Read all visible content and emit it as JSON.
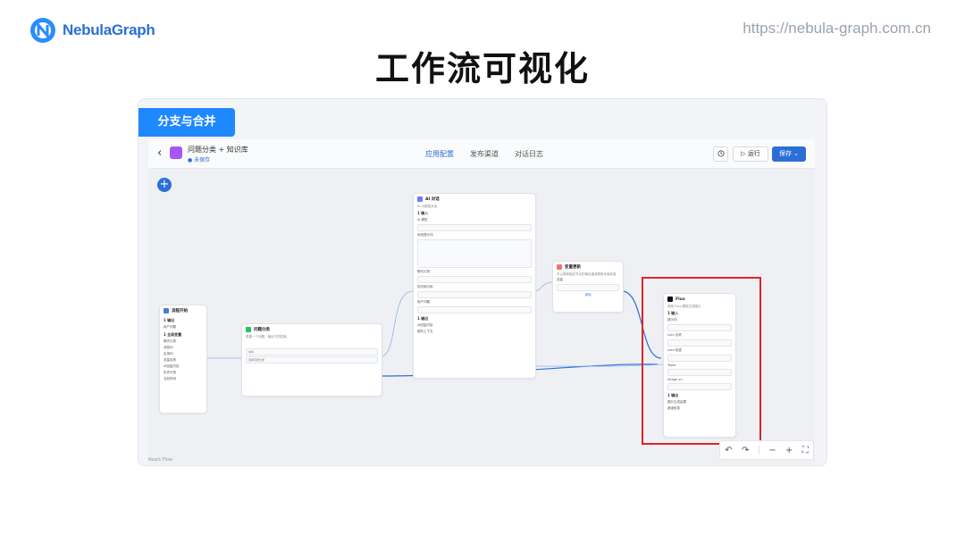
{
  "header": {
    "brand": "NebulaGraph",
    "url": "https://nebula-graph.com.cn",
    "title": "工作流可视化"
  },
  "section_tag": "分支与合并",
  "app": {
    "name": "问题分类 + 知识库",
    "status": "● 未保存",
    "tabs": [
      "应用配置",
      "发布渠道",
      "对话日志"
    ],
    "active_tab": "应用配置",
    "run_label": "▷ 运行",
    "save_label": "保存 ⌄"
  },
  "nodes": {
    "start": {
      "title": "流程开始",
      "rows": [
        "1 输出",
        "用户问题",
        "1 全局变量",
        "聊天记录",
        "消息ID",
        "应用ID",
        "变量名称",
        "AI回复内容",
        "历史记录",
        "当前时间"
      ]
    },
    "classifier": {
      "title": "问题分类",
      "sub": "根据一个问题，输出不同答案。",
      "rows": [
        "本科",
        "选择问题分类"
      ]
    },
    "ai": {
      "title": "AI 对话",
      "sub": "AI 大模型对话",
      "rows": [
        "1 输入",
        "AI 模型",
        "系统提示词",
        "聊天记录",
        "知识库引用",
        "用户问题",
        "1 输出",
        "AI回复内容",
        "新的上下文"
      ]
    },
    "update": {
      "title": "变量更新",
      "sub": "可以更新指定节点的输出值或更新全局变量",
      "rows": [
        "变量",
        "添加"
      ]
    },
    "flux": {
      "title": "Flux",
      "sub": "调用 Flux 模型生成图片",
      "rows": [
        "1 输入",
        "提示词",
        "Lora 名称",
        "Lora 权重",
        "Tasks",
        "Image url",
        "1 输出",
        "图片生成结果",
        "错误信息"
      ]
    }
  },
  "canvas": {
    "watermark": "React Flow"
  },
  "controls": [
    "↶",
    "↷",
    "−",
    "+",
    "⛶"
  ],
  "colors": {
    "accent": "#2b6fd6",
    "tag": "#1e88ff",
    "highlight": "#e02424"
  }
}
